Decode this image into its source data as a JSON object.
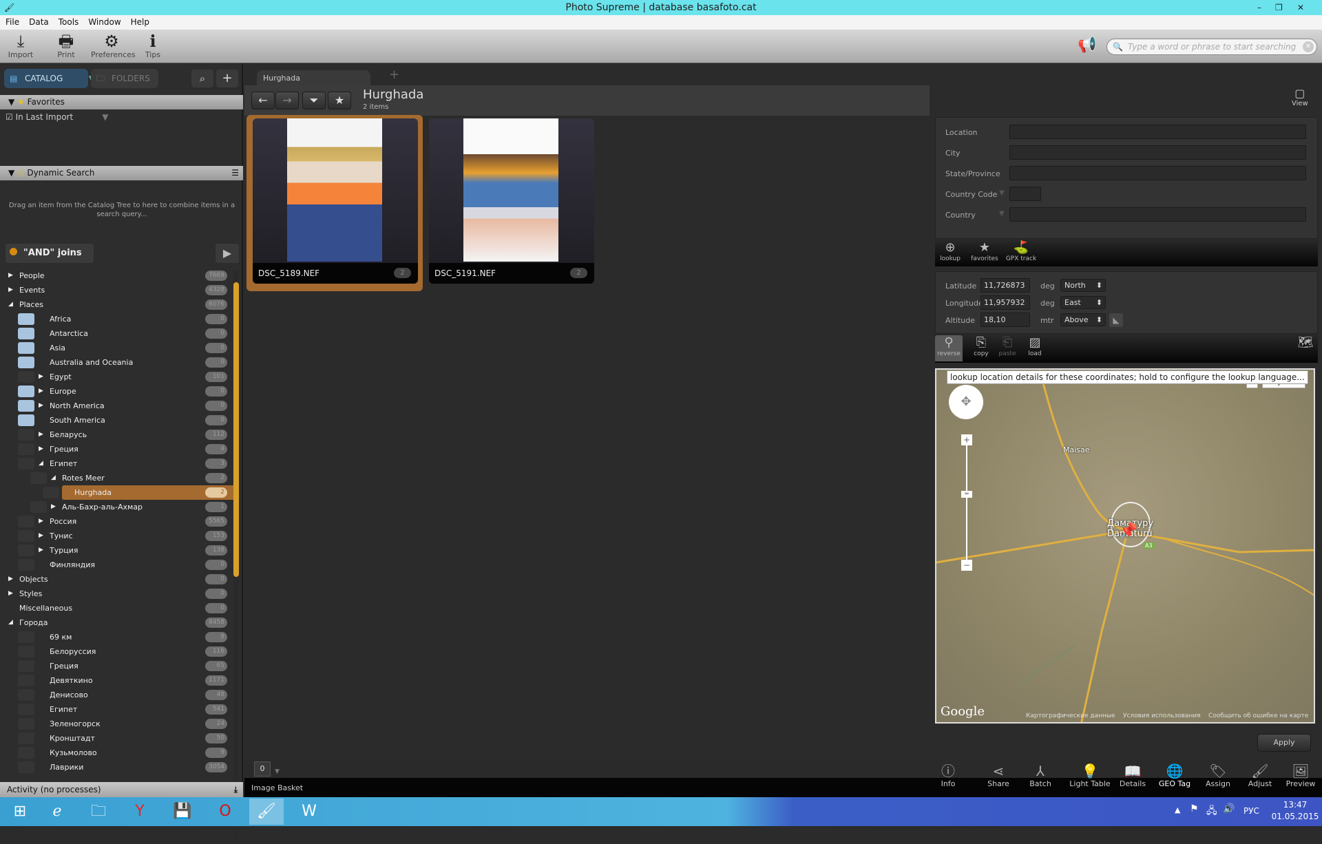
{
  "window": {
    "title": "Photo Supreme | database basafoto.cat"
  },
  "menu": [
    "File",
    "Data",
    "Tools",
    "Window",
    "Help"
  ],
  "toolbar": {
    "import": "Import",
    "print": "Print",
    "preferences": "Preferences",
    "tips": "Tips",
    "search_placeholder": "Type a word or phrase to start searching"
  },
  "left": {
    "catalog_tab": "CATALOG",
    "folders_tab": "FOLDERS",
    "favorites_header": "Favorites",
    "in_last_import": "In Last Import",
    "dynamic_search_header": "Dynamic Search",
    "dynamic_search_hint": "Drag an item from the Catalog Tree to here to combine items in a search query...",
    "and_joins": "\"AND\" joins",
    "tree": [
      {
        "label": "People",
        "count": "7669",
        "level": 0,
        "arrow": "right"
      },
      {
        "label": "Events",
        "count": "4328",
        "level": 0,
        "arrow": "right"
      },
      {
        "label": "Places",
        "count": "6076",
        "level": 0,
        "arrow": "down"
      },
      {
        "label": "Africa",
        "count": "0",
        "level": 1,
        "arrow": "",
        "map": true
      },
      {
        "label": "Antarctica",
        "count": "0",
        "level": 1,
        "arrow": "",
        "map": true
      },
      {
        "label": "Asia",
        "count": "0",
        "level": 1,
        "arrow": "",
        "map": true
      },
      {
        "label": "Australia and Oceania",
        "count": "0",
        "level": 1,
        "arrow": "",
        "map": true
      },
      {
        "label": "Egypt",
        "count": "101",
        "level": 1,
        "arrow": "right"
      },
      {
        "label": "Europe",
        "count": "0",
        "level": 1,
        "arrow": "right",
        "map": true
      },
      {
        "label": "North America",
        "count": "0",
        "level": 1,
        "arrow": "right",
        "map": true
      },
      {
        "label": "South America",
        "count": "0",
        "level": 1,
        "arrow": "",
        "map": true
      },
      {
        "label": "Беларусь",
        "count": "112",
        "level": 1,
        "arrow": "right"
      },
      {
        "label": "Греция",
        "count": "4",
        "level": 1,
        "arrow": "right"
      },
      {
        "label": "Египет",
        "count": "3",
        "level": 1,
        "arrow": "down"
      },
      {
        "label": "Rotes Meer",
        "count": "2",
        "level": 2,
        "arrow": "down"
      },
      {
        "label": "Hurghada",
        "count": "2",
        "level": 3,
        "arrow": "",
        "selected": true
      },
      {
        "label": "Аль-Бахр-аль-Ахмар",
        "count": "1",
        "level": 2,
        "arrow": "right"
      },
      {
        "label": "Россия",
        "count": "5565",
        "level": 1,
        "arrow": "right"
      },
      {
        "label": "Тунис",
        "count": "153",
        "level": 1,
        "arrow": "right"
      },
      {
        "label": "Турция",
        "count": "138",
        "level": 1,
        "arrow": "right"
      },
      {
        "label": "Финляндия",
        "count": "0",
        "level": 1,
        "arrow": ""
      },
      {
        "label": "Objects",
        "count": "0",
        "level": 0,
        "arrow": "right"
      },
      {
        "label": "Styles",
        "count": "0",
        "level": 0,
        "arrow": "right"
      },
      {
        "label": "Miscellaneous",
        "count": "0",
        "level": 0,
        "arrow": ""
      },
      {
        "label": "Города",
        "count": "8458",
        "level": 0,
        "arrow": "down"
      },
      {
        "label": "69 км",
        "count": "8",
        "level": 1,
        "arrow": ""
      },
      {
        "label": "Белоруссия",
        "count": "116",
        "level": 1,
        "arrow": ""
      },
      {
        "label": "Греция",
        "count": "65",
        "level": 1,
        "arrow": ""
      },
      {
        "label": "Девяткино",
        "count": "1171",
        "level": 1,
        "arrow": ""
      },
      {
        "label": "Денисово",
        "count": "48",
        "level": 1,
        "arrow": ""
      },
      {
        "label": "Египет",
        "count": "541",
        "level": 1,
        "arrow": ""
      },
      {
        "label": "Зеленогорск",
        "count": "24",
        "level": 1,
        "arrow": ""
      },
      {
        "label": "Кронштадт",
        "count": "50",
        "level": 1,
        "arrow": ""
      },
      {
        "label": "Кузьмолово",
        "count": "9",
        "level": 1,
        "arrow": ""
      },
      {
        "label": "Лаврики",
        "count": "3054",
        "level": 1,
        "arrow": ""
      }
    ],
    "activity": "Activity (no processes)"
  },
  "center": {
    "tab": "Hurghada",
    "title": "Hurghada",
    "subtitle": "2 items",
    "view": "View",
    "thumbnails": [
      {
        "name": "DSC_5189.NEF",
        "badge": "2",
        "selected": true
      },
      {
        "name": "DSC_5191.NEF",
        "badge": "2"
      }
    ],
    "basket_count": "0",
    "basket_label": "Image Basket"
  },
  "geo": {
    "location_label": "Location",
    "city_label": "City",
    "state_label": "State/Province",
    "country_code_label": "Country Code",
    "country_label": "Country",
    "lookup": "lookup",
    "favorites": "favorites",
    "gpx": "GPX track",
    "latitude_label": "Latitude",
    "latitude": "11,726873",
    "lat_unit": "deg",
    "lat_dir": "North",
    "longitude_label": "Longitude",
    "longitude": "11,957932",
    "lon_unit": "deg",
    "lon_dir": "East",
    "altitude_label": "Altitude",
    "altitude": "18,10",
    "alt_unit": "mtr",
    "alt_dir": "Above",
    "reverse": "reverse",
    "copy": "copy",
    "paste": "paste",
    "load": "load",
    "tooltip": "lookup location details for these coordinates; hold to configure the lookup language...",
    "map_type_partial": "a",
    "map_type_satellite": "Спутник",
    "map_place1": "Maisae",
    "map_place2": "Даматуру",
    "map_place3": "Damaturu",
    "map_road": "A3",
    "google": "Google",
    "map_data": "Картографические данные",
    "terms": "Условия использования",
    "report": "Сообщить об ошибке на карте",
    "apply": "Apply"
  },
  "bottom_tools": [
    "Info",
    "Share",
    "Batch",
    "Light Table",
    "Details",
    "GEO Tag",
    "Assign",
    "Adjust",
    "Preview"
  ],
  "taskbar": {
    "lang": "РУС",
    "time": "13:47",
    "date": "01.05.2015"
  }
}
